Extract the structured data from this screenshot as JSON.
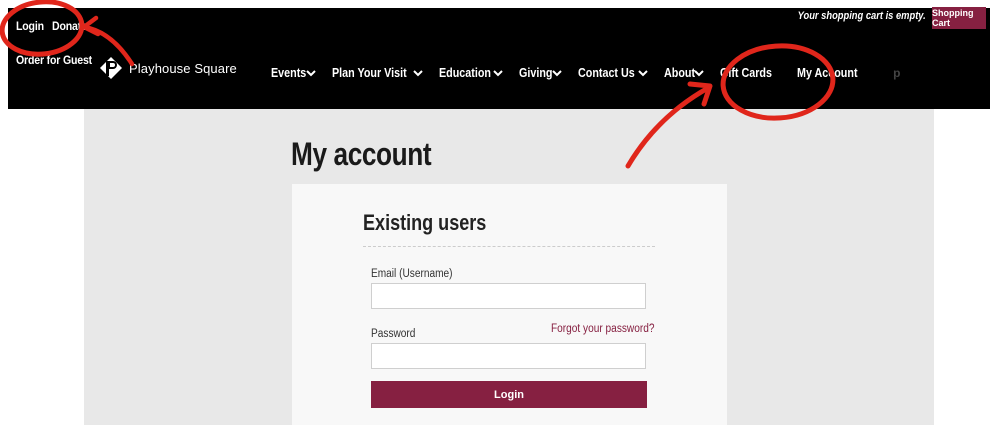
{
  "top_links": {
    "login": "Login",
    "donate": "Donate",
    "order_for_guest": "Order for Guest"
  },
  "cart": {
    "status": "Your shopping cart is empty.",
    "button": "Shopping Cart"
  },
  "brand": {
    "name": "Playhouse Square"
  },
  "nav": {
    "items": [
      {
        "label": "Events",
        "has_dropdown": true
      },
      {
        "label": "Plan Your Visit",
        "has_dropdown": true
      },
      {
        "label": "Education",
        "has_dropdown": true
      },
      {
        "label": "Giving",
        "has_dropdown": true
      },
      {
        "label": "Contact Us",
        "has_dropdown": true
      },
      {
        "label": "About",
        "has_dropdown": true
      },
      {
        "label": "Gift Cards",
        "has_dropdown": false
      },
      {
        "label": "My Account",
        "has_dropdown": false
      }
    ],
    "trailing_faint": "p"
  },
  "page": {
    "title": "My account"
  },
  "login_form": {
    "heading": "Existing users",
    "email_label": "Email (Username)",
    "email_value": "",
    "password_label": "Password",
    "password_value": "",
    "forgot_link": "Forgot your password?",
    "submit_label": "Login"
  },
  "colors": {
    "brand_maroon": "#862041",
    "header_bg": "#000000",
    "annotation_red": "#e0261b",
    "content_bg": "#e8e8e8"
  }
}
